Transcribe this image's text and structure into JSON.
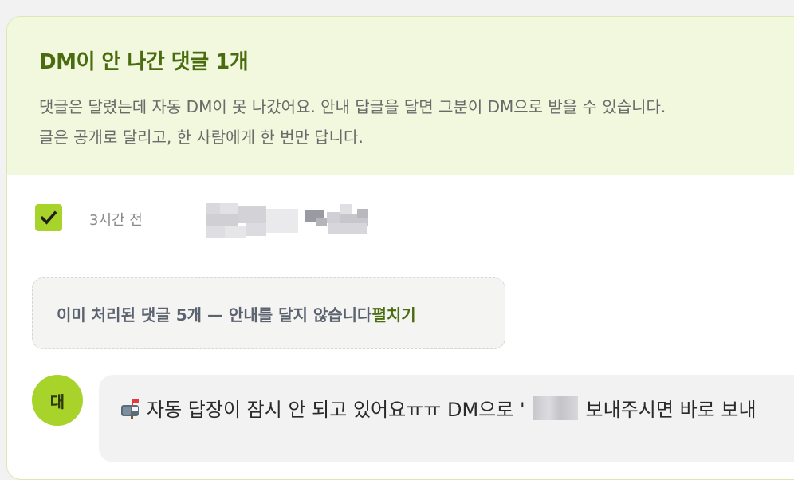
{
  "panel": {
    "title": "DM이 안 나간 댓글 1개",
    "description_line1": "댓글은 달렸는데 자동 DM이 못 나갔어요. 안내 답글을 달면 그분이 DM으로 받을 수 있습니다.",
    "description_line2": "글은 공개로 달리고, 한 사람에게 한 번만 답니다."
  },
  "comment_row": {
    "checked": true,
    "timestamp": "3시간 전"
  },
  "notice": {
    "text": "이미 처리된 댓글 5개 — 안내를 달지 않습니다",
    "expand_label": "펼치기"
  },
  "reply": {
    "avatar_initial": "대",
    "icon": "mailbox-icon",
    "text_before": "자동 답장이 잠시 안 되고 있어요ㅠㅠ DM으로 '",
    "text_after": " 보내주시면 바로 보내"
  },
  "colors": {
    "accent": "#a8d32a",
    "accent_dark": "#4a6b0e",
    "header_bg": "#f1f8dd"
  }
}
